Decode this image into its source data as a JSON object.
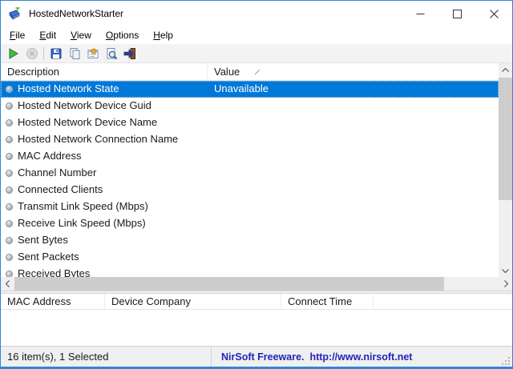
{
  "window": {
    "title": "HostedNetworkStarter",
    "border_color": "#2e86d5"
  },
  "menu": {
    "items": [
      {
        "label": "File"
      },
      {
        "label": "Edit"
      },
      {
        "label": "View"
      },
      {
        "label": "Options"
      },
      {
        "label": "Help"
      }
    ]
  },
  "toolbar": {
    "buttons": [
      {
        "icon": "start-hosted-network-icon",
        "enabled": true
      },
      {
        "icon": "stop-hosted-network-icon",
        "enabled": false
      },
      {
        "icon": "save-icon",
        "enabled": true
      },
      {
        "icon": "copy-icon",
        "enabled": true
      },
      {
        "icon": "properties-icon",
        "enabled": true
      },
      {
        "icon": "find-icon",
        "enabled": true
      },
      {
        "icon": "exit-icon",
        "enabled": true
      }
    ]
  },
  "list": {
    "columns": [
      {
        "label": "Description",
        "sorted": false
      },
      {
        "label": "Value",
        "sorted": true
      }
    ],
    "rows": [
      {
        "description": "Hosted Network State",
        "value": "Unavailable",
        "selected": true
      },
      {
        "description": "Hosted Network Device Guid",
        "value": "",
        "selected": false
      },
      {
        "description": "Hosted Network Device Name",
        "value": "",
        "selected": false
      },
      {
        "description": "Hosted Network Connection Name",
        "value": "",
        "selected": false
      },
      {
        "description": "MAC Address",
        "value": "",
        "selected": false
      },
      {
        "description": "Channel Number",
        "value": "",
        "selected": false
      },
      {
        "description": "Connected Clients",
        "value": "",
        "selected": false
      },
      {
        "description": "Transmit Link Speed (Mbps)",
        "value": "",
        "selected": false
      },
      {
        "description": "Receive Link Speed (Mbps)",
        "value": "",
        "selected": false
      },
      {
        "description": "Sent Bytes",
        "value": "",
        "selected": false
      },
      {
        "description": "Sent Packets",
        "value": "",
        "selected": false
      },
      {
        "description": "Received Bytes",
        "value": "",
        "selected": false
      }
    ],
    "selection_color": "#0078d7"
  },
  "clients_panel": {
    "columns": [
      {
        "label": "MAC Address"
      },
      {
        "label": "Device Company"
      },
      {
        "label": "Connect Time"
      }
    ],
    "rows": []
  },
  "status_bar": {
    "left": "16 item(s), 1 Selected",
    "right": "NirSoft Freeware.  http://www.nirsoft.net",
    "right_color": "#2424bb"
  }
}
